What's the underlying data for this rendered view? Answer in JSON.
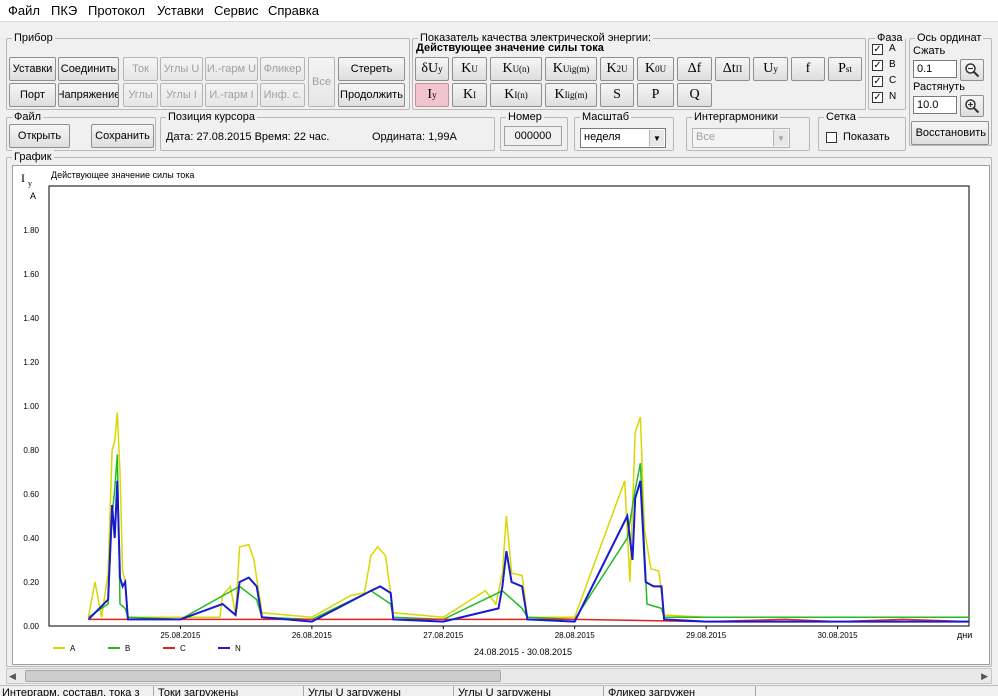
{
  "menu": [
    "Файл",
    "ПКЭ",
    "Протокол",
    "Уставки",
    "Сервис",
    "Справка"
  ],
  "device": {
    "title": "Прибор",
    "settings": "Уставки",
    "connect": "Соединить",
    "current": "Ток",
    "angles_u": "Углы U",
    "iharm_u": "И.-гарм U",
    "flicker": "Фликер",
    "all": "Все",
    "erase": "Стереть",
    "port": "Порт",
    "voltage": "Напряжение",
    "angles": "Углы",
    "angles_i": "Углы I",
    "iharm_i": "И.-гарм I",
    "info": "Инф. с.",
    "continue": "Продолжить"
  },
  "pqe": {
    "title": "Показатель качества электрической энергии:",
    "subtitle": "Действующее значение силы тока",
    "row1": [
      {
        "main": "δU",
        "sub": "y"
      },
      {
        "main": "K",
        "sub": "U"
      },
      {
        "main": "K",
        "sub": "U(n)"
      },
      {
        "main": "K",
        "sub": "Uig(m)"
      },
      {
        "main": "K",
        "sub": "2U"
      },
      {
        "main": "K",
        "sub": "0U"
      },
      {
        "main": "Δf",
        "sub": ""
      },
      {
        "main": "Δt",
        "sub": "П"
      },
      {
        "main": "U",
        "sub": "y"
      },
      {
        "main": "f",
        "sub": ""
      },
      {
        "main": "P",
        "sub": "st"
      }
    ],
    "row2": [
      {
        "main": "I",
        "sub": "y"
      },
      {
        "main": "K",
        "sub": "I"
      },
      {
        "main": "K",
        "sub": "I(n)"
      },
      {
        "main": "K",
        "sub": "Iig(m)"
      },
      {
        "main": "S",
        "sub": ""
      },
      {
        "main": "P",
        "sub": ""
      },
      {
        "main": "Q",
        "sub": ""
      }
    ],
    "active_color": "#f2c4cf"
  },
  "phase": {
    "title": "Фаза",
    "items": [
      {
        "label": "A",
        "checked": true
      },
      {
        "label": "B",
        "checked": true
      },
      {
        "label": "C",
        "checked": true
      },
      {
        "label": "N",
        "checked": true
      }
    ]
  },
  "ordinate": {
    "title": "Ось ординат",
    "compress": "Сжать",
    "compress_value": "0.1",
    "stretch": "Растянуть",
    "stretch_value": "10.0",
    "restore": "Восстановить"
  },
  "file": {
    "title": "Файл",
    "open": "Открыть",
    "save": "Сохранить"
  },
  "cursor": {
    "title": "Позиция курсора",
    "text": "Дата: 27.08.2015 Время: 22 час.",
    "ordinate": "Ордината:  1,99А"
  },
  "number": {
    "title": "Номер",
    "value": "000000"
  },
  "scale": {
    "title": "Масштаб",
    "value": "неделя"
  },
  "interharm": {
    "title": "Интергармоники",
    "value": "Все"
  },
  "grid": {
    "title": "Сетка",
    "label": "Показать",
    "checked": false
  },
  "graph": {
    "title": "График"
  },
  "chart_data": {
    "type": "line",
    "title": "Действующее значение силы тока",
    "ylabel": "I",
    "ylabel_sub": "y",
    "yunit": "A",
    "xlabel": "24.08.2015 - 30.08.2015",
    "xunit": "дни",
    "ylim": [
      0,
      2.0
    ],
    "yticks": [
      "0.00",
      "0.20",
      "0.40",
      "0.60",
      "0.80",
      "1.00",
      "1.20",
      "1.40",
      "1.60",
      "1.80"
    ],
    "xticks": [
      "25.08.2015",
      "26.08.2015",
      "27.08.2015",
      "28.08.2015",
      "29.08.2015",
      "30.08.2015"
    ],
    "xlim": [
      "24.08.2015",
      "31.08.2015"
    ],
    "grid": false,
    "legend_position": "bottom-left",
    "series": [
      {
        "name": "A",
        "color": "#d8d800",
        "points": [
          [
            0.3,
            0.04
          ],
          [
            0.35,
            0.2
          ],
          [
            0.4,
            0.04
          ],
          [
            0.45,
            0.24
          ],
          [
            0.48,
            0.8
          ],
          [
            0.5,
            0.84
          ],
          [
            0.52,
            0.97
          ],
          [
            0.54,
            0.7
          ],
          [
            0.56,
            0.25
          ],
          [
            0.58,
            0.2
          ],
          [
            0.6,
            0.04
          ],
          [
            1.0,
            0.04
          ],
          [
            1.3,
            0.04
          ],
          [
            1.32,
            0.14
          ],
          [
            1.38,
            0.18
          ],
          [
            1.42,
            0.05
          ],
          [
            1.45,
            0.36
          ],
          [
            1.52,
            0.37
          ],
          [
            1.56,
            0.3
          ],
          [
            1.62,
            0.06
          ],
          [
            2.0,
            0.04
          ],
          [
            2.3,
            0.14
          ],
          [
            2.4,
            0.15
          ],
          [
            2.45,
            0.32
          ],
          [
            2.5,
            0.36
          ],
          [
            2.56,
            0.32
          ],
          [
            2.62,
            0.06
          ],
          [
            3.0,
            0.04
          ],
          [
            3.32,
            0.16
          ],
          [
            3.4,
            0.1
          ],
          [
            3.45,
            0.24
          ],
          [
            3.48,
            0.5
          ],
          [
            3.52,
            0.24
          ],
          [
            3.6,
            0.23
          ],
          [
            3.64,
            0.04
          ],
          [
            4.0,
            0.04
          ],
          [
            4.38,
            0.66
          ],
          [
            4.42,
            0.2
          ],
          [
            4.46,
            0.88
          ],
          [
            4.5,
            0.95
          ],
          [
            4.53,
            0.44
          ],
          [
            4.58,
            0.26
          ],
          [
            4.64,
            0.25
          ],
          [
            4.68,
            0.05
          ],
          [
            5.0,
            0.04
          ],
          [
            6.0,
            0.04
          ],
          [
            7.0,
            0.04
          ]
        ]
      },
      {
        "name": "B",
        "color": "#22bb22",
        "points": [
          [
            0.3,
            0.04
          ],
          [
            0.45,
            0.1
          ],
          [
            0.48,
            0.5
          ],
          [
            0.5,
            0.62
          ],
          [
            0.52,
            0.78
          ],
          [
            0.54,
            0.1
          ],
          [
            0.58,
            0.08
          ],
          [
            0.6,
            0.04
          ],
          [
            1.0,
            0.03
          ],
          [
            1.45,
            0.18
          ],
          [
            1.58,
            0.12
          ],
          [
            1.62,
            0.04
          ],
          [
            2.0,
            0.03
          ],
          [
            2.45,
            0.16
          ],
          [
            2.6,
            0.1
          ],
          [
            2.62,
            0.04
          ],
          [
            3.0,
            0.03
          ],
          [
            3.45,
            0.16
          ],
          [
            3.6,
            0.08
          ],
          [
            3.64,
            0.04
          ],
          [
            4.0,
            0.03
          ],
          [
            4.4,
            0.4
          ],
          [
            4.46,
            0.62
          ],
          [
            4.5,
            0.74
          ],
          [
            4.55,
            0.1
          ],
          [
            4.66,
            0.08
          ],
          [
            4.68,
            0.04
          ],
          [
            5.0,
            0.04
          ],
          [
            6.0,
            0.04
          ],
          [
            7.0,
            0.04
          ]
        ]
      },
      {
        "name": "C",
        "color": "#dd2222",
        "points": [
          [
            0.3,
            0.03
          ],
          [
            1.0,
            0.03
          ],
          [
            2.0,
            0.03
          ],
          [
            3.0,
            0.03
          ],
          [
            4.0,
            0.03
          ],
          [
            5.0,
            0.02
          ],
          [
            5.6,
            0.03
          ],
          [
            6.0,
            0.02
          ],
          [
            6.5,
            0.03
          ],
          [
            7.0,
            0.02
          ]
        ]
      },
      {
        "name": "N",
        "color": "#1a1ad0",
        "points": [
          [
            0.3,
            0.03
          ],
          [
            0.45,
            0.12
          ],
          [
            0.48,
            0.55
          ],
          [
            0.5,
            0.4
          ],
          [
            0.52,
            0.66
          ],
          [
            0.54,
            0.22
          ],
          [
            0.56,
            0.18
          ],
          [
            0.58,
            0.2
          ],
          [
            0.6,
            0.03
          ],
          [
            1.0,
            0.03
          ],
          [
            1.32,
            0.1
          ],
          [
            1.42,
            0.05
          ],
          [
            1.45,
            0.2
          ],
          [
            1.52,
            0.22
          ],
          [
            1.58,
            0.18
          ],
          [
            1.62,
            0.04
          ],
          [
            2.0,
            0.02
          ],
          [
            2.45,
            0.16
          ],
          [
            2.52,
            0.18
          ],
          [
            2.6,
            0.15
          ],
          [
            2.62,
            0.03
          ],
          [
            3.0,
            0.02
          ],
          [
            3.42,
            0.08
          ],
          [
            3.45,
            0.18
          ],
          [
            3.48,
            0.34
          ],
          [
            3.52,
            0.2
          ],
          [
            3.6,
            0.18
          ],
          [
            3.64,
            0.03
          ],
          [
            4.0,
            0.02
          ],
          [
            4.4,
            0.5
          ],
          [
            4.44,
            0.3
          ],
          [
            4.46,
            0.58
          ],
          [
            4.5,
            0.66
          ],
          [
            4.54,
            0.2
          ],
          [
            4.6,
            0.18
          ],
          [
            4.66,
            0.18
          ],
          [
            4.68,
            0.03
          ],
          [
            5.0,
            0.02
          ],
          [
            6.0,
            0.02
          ],
          [
            7.0,
            0.02
          ]
        ]
      }
    ]
  },
  "status": [
    "Интергарм. составл. тока з",
    "Токи загружены",
    "Углы U загружены",
    "Углы U загружены",
    "Фликер загружен"
  ]
}
